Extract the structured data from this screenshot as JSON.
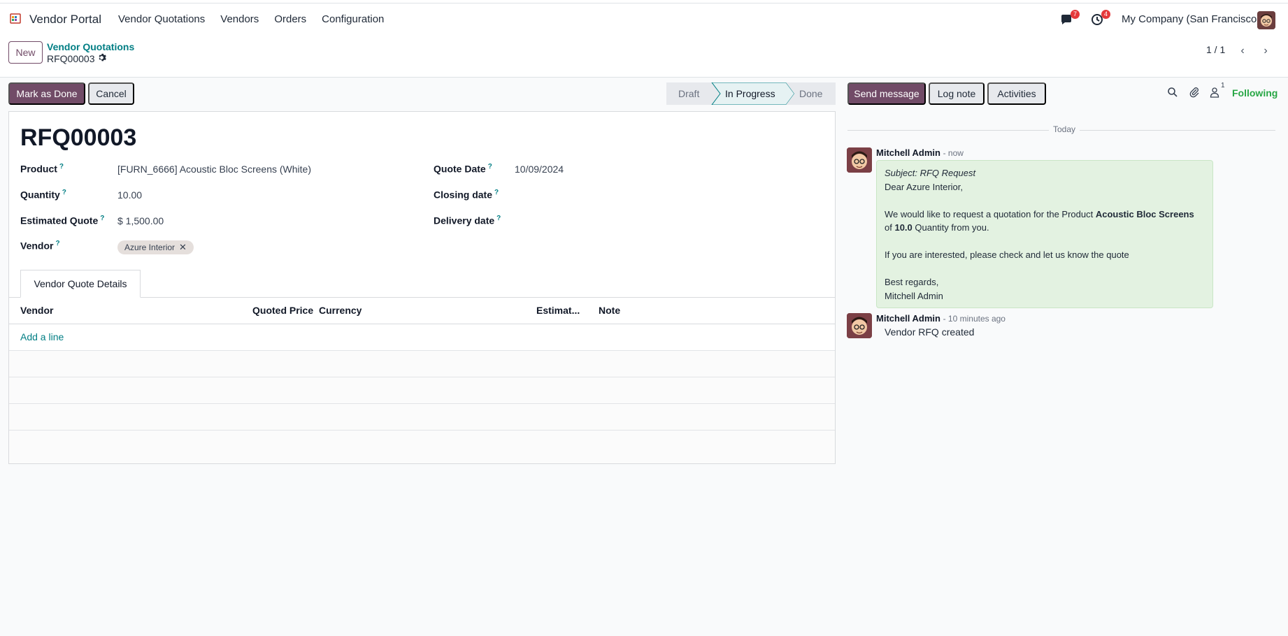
{
  "navbar": {
    "brand": "Vendor Portal",
    "menu": [
      "Vendor Quotations",
      "Vendors",
      "Orders",
      "Configuration"
    ],
    "messages_badge": "7",
    "activities_badge": "4",
    "company": "My Company (San Francisco)"
  },
  "control": {
    "new_label": "New",
    "breadcrumb_parent": "Vendor Quotations",
    "breadcrumb_current": "RFQ00003",
    "pager": "1 / 1"
  },
  "statusbar": {
    "mark_done": "Mark as Done",
    "cancel": "Cancel",
    "steps": [
      "Draft",
      "In Progress",
      "Done"
    ],
    "active_step": "In Progress"
  },
  "form": {
    "title": "RFQ00003",
    "fields": {
      "product_label": "Product",
      "product_value": "[FURN_6666] Acoustic Bloc Screens (White)",
      "quantity_label": "Quantity",
      "quantity_value": "10.00",
      "estimated_label": "Estimated Quote",
      "estimated_value": "$ 1,500.00",
      "vendor_label": "Vendor",
      "vendor_tag": "Azure Interior",
      "quote_date_label": "Quote Date",
      "quote_date_value": "10/09/2024",
      "closing_date_label": "Closing date",
      "delivery_date_label": "Delivery date",
      "help_mark": "?"
    },
    "tab": "Vendor Quote Details",
    "columns": [
      "Vendor",
      "Quoted Price",
      "Currency",
      "Estimat...",
      "Note"
    ],
    "add_line": "Add a line"
  },
  "chatter": {
    "send_message": "Send message",
    "log_note": "Log note",
    "activities": "Activities",
    "followers_count": "1",
    "following": "Following",
    "date_separator": "Today",
    "messages": [
      {
        "author": "Mitchell Admin",
        "time": "- now",
        "subject": "Subject: RFQ Request",
        "greeting": "Dear Azure Interior,",
        "line1_a": "We would like to request a quotation for the Product ",
        "line1_b": "Acoustic Bloc Screens",
        "line2_a": "of ",
        "line2_b": "10.0",
        "line2_c": " Quantity from you.",
        "line3": "If you are interested, please check and let us know the quote",
        "closing": "Best regards,",
        "signature": "Mitchell Admin"
      },
      {
        "author": "Mitchell Admin",
        "time": "- 10 minutes ago",
        "body": "Vendor RFQ created"
      }
    ]
  },
  "colors": {
    "primary": "#714b67",
    "link": "#017e84",
    "following": "#28a745",
    "message_bg": "#e3f2e1"
  }
}
